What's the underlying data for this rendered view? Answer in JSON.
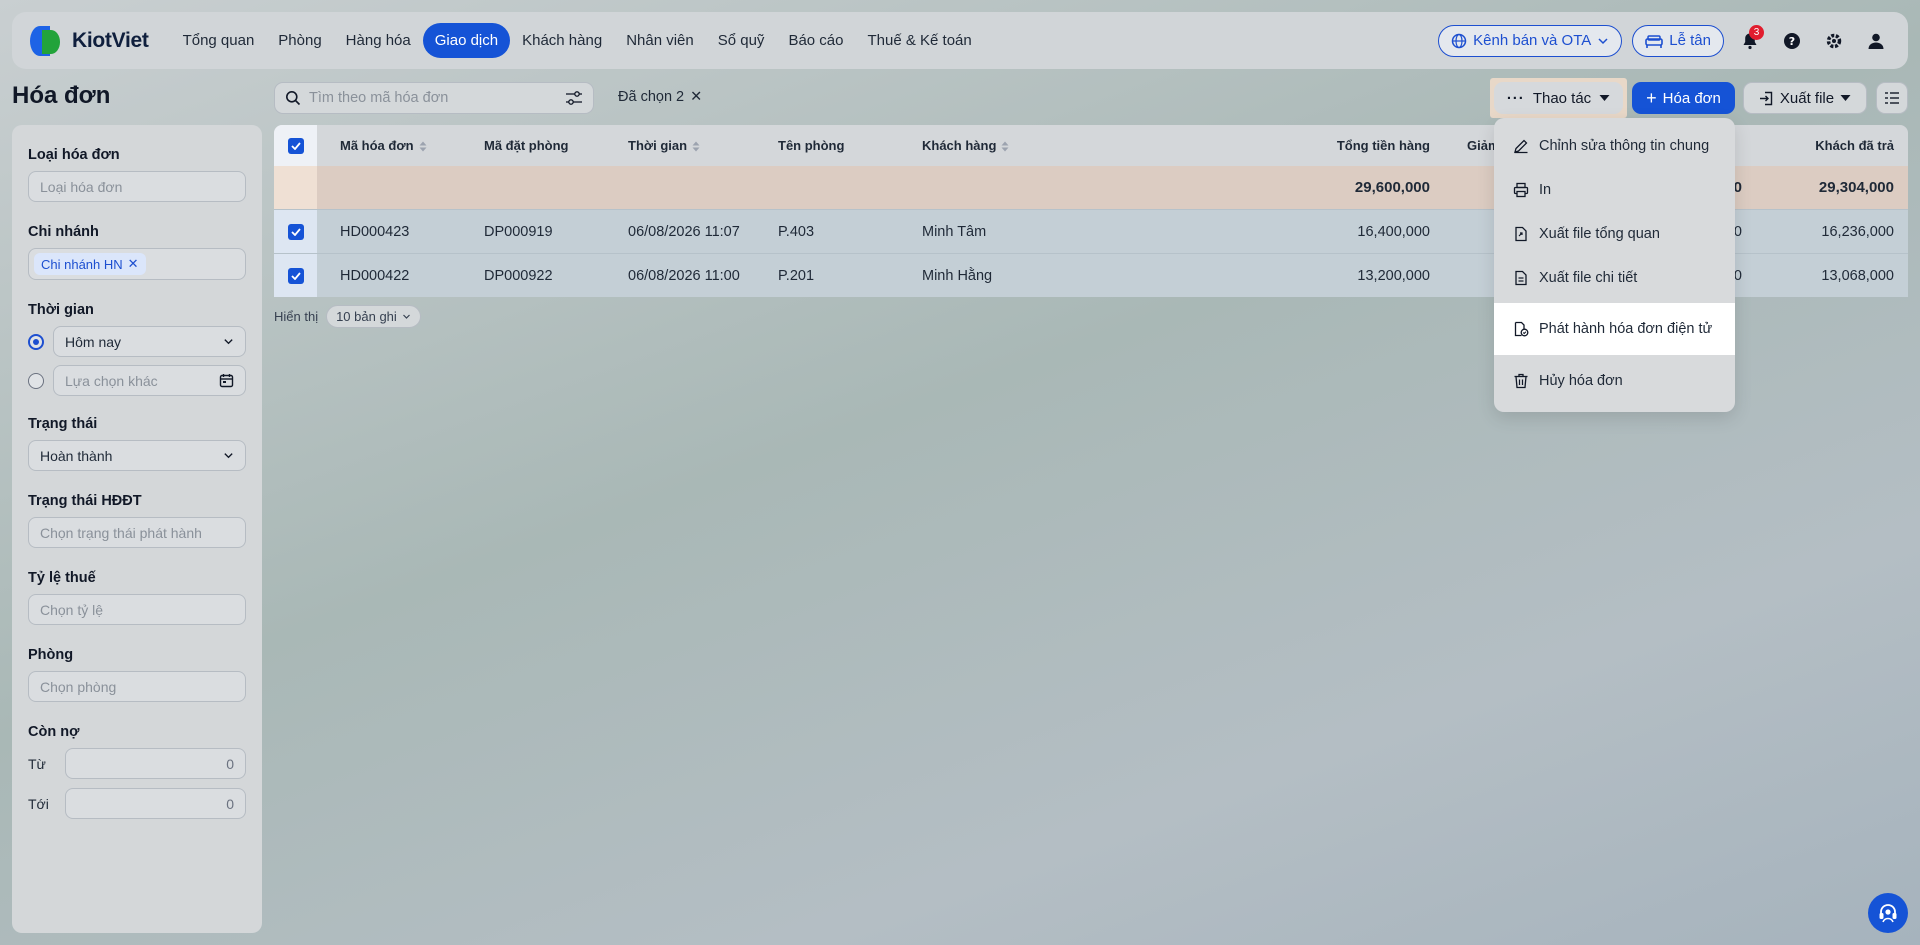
{
  "brand": {
    "name": "KiotViet"
  },
  "nav": {
    "items": [
      "Tổng quan",
      "Phòng",
      "Hàng hóa",
      "Giao dịch",
      "Khách hàng",
      "Nhân viên",
      "Sổ quỹ",
      "Báo cáo",
      "Thuế & Kế toán"
    ],
    "active": "Giao dịch"
  },
  "topright": {
    "channel_label": "Kênh bán và OTA",
    "reception_label": "Lễ tân",
    "notification_count": "3"
  },
  "page": {
    "title": "Hóa đơn"
  },
  "filters": {
    "invoice_type": {
      "label": "Loại hóa đơn",
      "placeholder": "Loại hóa đơn"
    },
    "branch": {
      "label": "Chi nhánh",
      "tag": "Chi nhánh HN"
    },
    "time": {
      "label": "Thời gian",
      "option_today": "Hôm nay",
      "option_other": "Lựa chọn khác",
      "selected": "today"
    },
    "status": {
      "label": "Trạng thái",
      "value": "Hoàn thành"
    },
    "einvoice_status": {
      "label": "Trạng thái HĐĐT",
      "placeholder": "Chọn trạng thái phát hành"
    },
    "tax_rate": {
      "label": "Tỷ lệ thuế",
      "placeholder": "Chọn tỷ lệ"
    },
    "room": {
      "label": "Phòng",
      "placeholder": "Chọn phòng"
    },
    "debt": {
      "label": "Còn nợ",
      "from_label": "Từ",
      "from_value": "0",
      "to_label": "Tới",
      "to_value": "0"
    }
  },
  "toolbar": {
    "search_placeholder": "Tìm theo mã hóa đơn",
    "selected_label": "Đã chọn 2",
    "actions_label": "Thao tác",
    "new_invoice_label": "Hóa đơn",
    "export_label": "Xuất file"
  },
  "table": {
    "columns": {
      "code": "Mã hóa đơn",
      "booking": "Mã đặt phòng",
      "time": "Thời gian",
      "room": "Tên phòng",
      "customer": "Khách hàng",
      "total": "Tổng tiền hàng",
      "discount": "Giảm",
      "paid": "Khách đã trả"
    },
    "summary": {
      "total": "29,600,000",
      "discount": "0",
      "paid": "29,304,000"
    },
    "rows": [
      {
        "code": "HD000423",
        "booking": "DP000919",
        "time": "06/08/2026 11:07",
        "room": "P.403",
        "customer": "Minh Tâm",
        "total": "16,400,000",
        "discount": "0",
        "paid": "16,236,000",
        "checked": true
      },
      {
        "code": "HD000422",
        "booking": "DP000922",
        "time": "06/08/2026 11:00",
        "room": "P.201",
        "customer": "Minh Hằng",
        "total": "13,200,000",
        "discount": "0",
        "paid": "13,068,000",
        "checked": true
      }
    ]
  },
  "pager": {
    "label": "Hiển thị",
    "page_size": "10 bản ghi"
  },
  "actions_menu": {
    "items": [
      {
        "label": "Chỉnh sửa thông tin chung",
        "icon": "pencil-icon"
      },
      {
        "label": "In",
        "icon": "printer-icon"
      },
      {
        "label": "Xuất file tổng quan",
        "icon": "file-export-icon"
      },
      {
        "label": "Xuất file chi tiết",
        "icon": "file-detail-icon"
      },
      {
        "label": "Phát hành hóa đơn điện tử",
        "icon": "e-invoice-icon",
        "highlighted": true
      },
      {
        "label": "Hủy hóa đơn",
        "icon": "trash-icon"
      }
    ]
  },
  "colors": {
    "primary": "#1553d6",
    "badge": "#e11d2e"
  }
}
